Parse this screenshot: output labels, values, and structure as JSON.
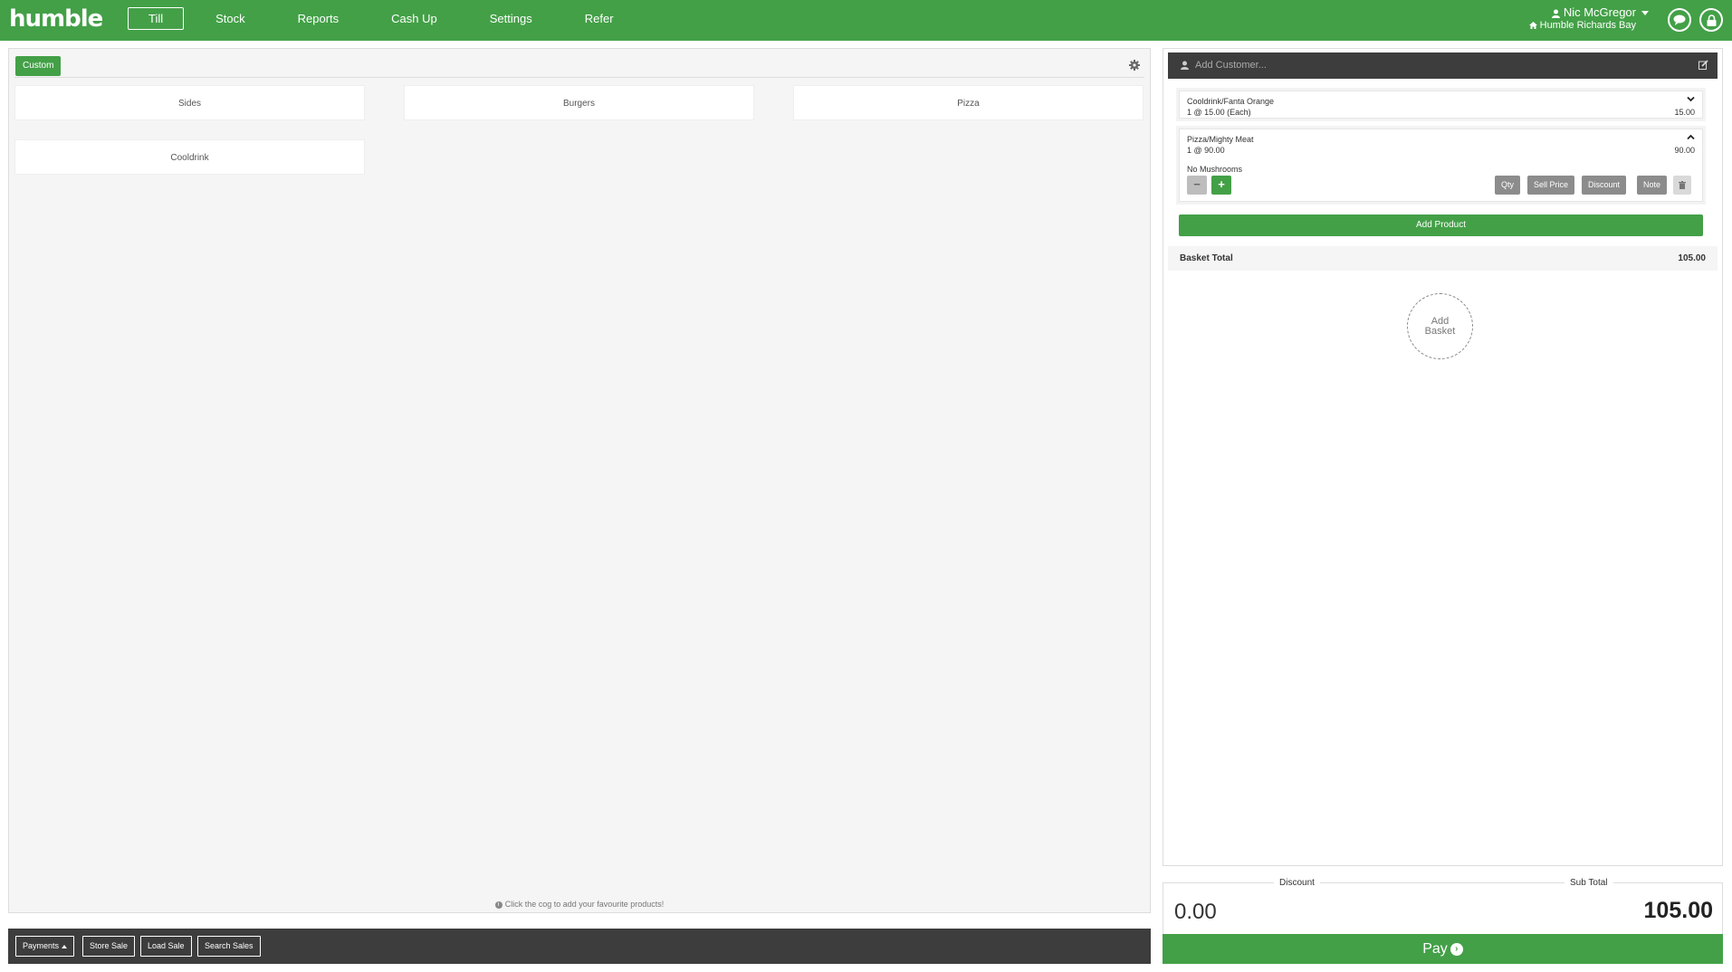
{
  "app": {
    "logo": "humble"
  },
  "nav": [
    {
      "label": "Till",
      "active": true
    },
    {
      "label": "Stock"
    },
    {
      "label": "Reports"
    },
    {
      "label": "Cash Up"
    },
    {
      "label": "Settings"
    },
    {
      "label": "Refer"
    }
  ],
  "user": {
    "name": "Nic McGregor",
    "store": "Humble Richards Bay"
  },
  "left": {
    "tab_label": "Custom",
    "categories": [
      "Sides",
      "Burgers",
      "Pizza",
      "Cooldrink"
    ],
    "hint": "Click the cog to add your favourite products!"
  },
  "bottom": {
    "payments": "Payments",
    "store_sale": "Store Sale",
    "load_sale": "Load Sale",
    "search_sales": "Search Sales"
  },
  "basket": {
    "customer_placeholder": "Add Customer...",
    "items": [
      {
        "name": "Cooldrink/Fanta Orange",
        "qty_line": "1 @ 15.00 (Each)",
        "price": "15.00"
      },
      {
        "name": "Pizza/Mighty Meat",
        "qty_line": "1 @ 90.00",
        "price": "90.00",
        "note": "No Mushrooms"
      }
    ],
    "actions": {
      "minus": "−",
      "plus": "+",
      "qty": "Qty",
      "sell_price": "Sell Price",
      "discount": "Discount",
      "note": "Note"
    },
    "add_product": "Add Product",
    "total_label": "Basket Total",
    "total_value": "105.00",
    "add_basket_line1": "Add",
    "add_basket_line2": "Basket"
  },
  "totals": {
    "discount_label": "Discount",
    "discount_value": "0.00",
    "subtotal_label": "Sub Total",
    "subtotal_value": "105.00"
  },
  "pay": {
    "label": "Pay",
    "icon": "chevron-circle-right-icon"
  },
  "colors": {
    "brand": "#43a047",
    "dark_bar": "#3d3d3d"
  }
}
